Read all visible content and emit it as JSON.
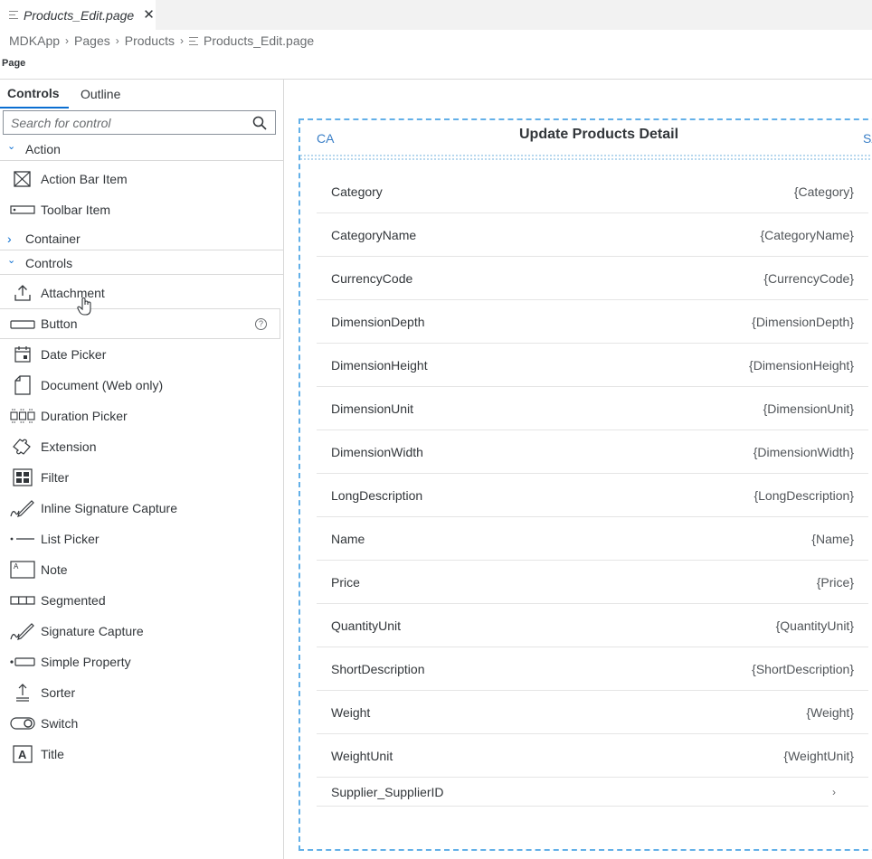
{
  "tab": {
    "title": "Products_Edit.page",
    "close": "✕"
  },
  "breadcrumb": {
    "items": [
      "MDKApp",
      "Pages",
      "Products",
      "Products_Edit.page"
    ],
    "sep": "›"
  },
  "page_label": "Page",
  "panel": {
    "tabs": [
      "Controls",
      "Outline"
    ],
    "search_placeholder": "Search for control",
    "groups": {
      "action": "Action",
      "container": "Container",
      "controls": "Controls"
    },
    "group_chevrons": {
      "expanded": "⌄",
      "collapsed": "›"
    },
    "action_items": [
      {
        "label": "Action Bar Item",
        "icon": "action-bar-item-icon"
      },
      {
        "label": "Toolbar Item",
        "icon": "toolbar-item-icon"
      }
    ],
    "control_items": [
      {
        "label": "Attachment",
        "icon": "upload-icon"
      },
      {
        "label": "Button",
        "icon": "button-icon"
      },
      {
        "label": "Date Picker",
        "icon": "calendar-icon"
      },
      {
        "label": "Document (Web only)",
        "icon": "document-icon"
      },
      {
        "label": "Duration Picker",
        "icon": "duration-icon"
      },
      {
        "label": "Extension",
        "icon": "puzzle-icon"
      },
      {
        "label": "Filter",
        "icon": "filter-grid-icon"
      },
      {
        "label": "Inline Signature Capture",
        "icon": "signature-icon"
      },
      {
        "label": "List Picker",
        "icon": "list-picker-icon"
      },
      {
        "label": "Note",
        "icon": "note-icon"
      },
      {
        "label": "Segmented",
        "icon": "segmented-icon"
      },
      {
        "label": "Signature Capture",
        "icon": "signature-icon"
      },
      {
        "label": "Simple Property",
        "icon": "simple-property-icon"
      },
      {
        "label": "Sorter",
        "icon": "sorter-icon"
      },
      {
        "label": "Switch",
        "icon": "switch-icon"
      },
      {
        "label": "Title",
        "icon": "title-icon"
      }
    ],
    "help_glyph": "?"
  },
  "canvas": {
    "cancel": "CA",
    "title": "Update Products Detail",
    "save": "SA",
    "rows": [
      {
        "key": "Category",
        "value": "{Category}"
      },
      {
        "key": "CategoryName",
        "value": "{CategoryName}"
      },
      {
        "key": "CurrencyCode",
        "value": "{CurrencyCode}"
      },
      {
        "key": "DimensionDepth",
        "value": "{DimensionDepth}"
      },
      {
        "key": "DimensionHeight",
        "value": "{DimensionHeight}"
      },
      {
        "key": "DimensionUnit",
        "value": "{DimensionUnit}"
      },
      {
        "key": "DimensionWidth",
        "value": "{DimensionWidth}"
      },
      {
        "key": "LongDescription",
        "value": "{LongDescription}"
      },
      {
        "key": "Name",
        "value": "{Name}"
      },
      {
        "key": "Price",
        "value": "{Price}"
      },
      {
        "key": "QuantityUnit",
        "value": "{QuantityUnit}"
      },
      {
        "key": "ShortDescription",
        "value": "{ShortDescription}"
      },
      {
        "key": "Weight",
        "value": "{Weight}"
      },
      {
        "key": "WeightUnit",
        "value": "{WeightUnit}"
      }
    ],
    "nav_row": {
      "key": "Supplier_SupplierID",
      "chevron": "›"
    }
  }
}
